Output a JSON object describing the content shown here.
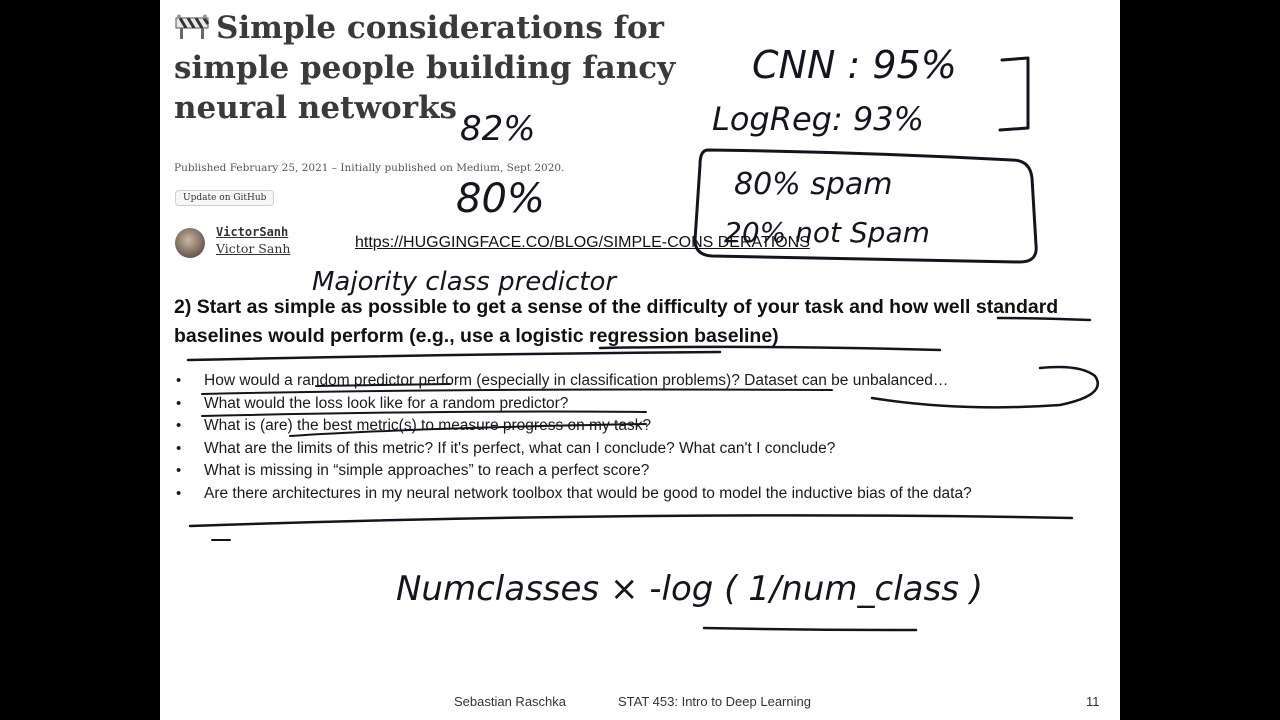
{
  "blog": {
    "icon": "construction-barrier-icon",
    "title": "Simple considerations for simple people building fancy neural networks",
    "published": "Published February 25, 2021 – Initially published on Medium, Sept 2020.",
    "github_button": "Update on GitHub",
    "author_handle": "VictorSanh",
    "author_name": "Victor Sanh",
    "url": "https://HUGGINGFACE.CO/BLOG/SIMPLE-CONS DERATIONS"
  },
  "slide": {
    "heading": "2)  Start as simple as possible to get a sense of the difficulty of your task and how well standard baselines would perform (e.g., use a logistic regression baseline)",
    "bullets": [
      "How would a random predictor perform (especially in classification problems)? Dataset can be unbalanced…",
      "What would the loss look like for a random predictor?",
      "What is (are) the best metric(s) to measure progress on my task?",
      "What are the limits of this metric? If it's perfect, what can I conclude? What can't I conclude?",
      "What is missing in “simple approaches” to reach a perfect score?",
      "Are there architectures in my neural network toolbox that would be good to model the inductive bias of the data?"
    ]
  },
  "annotations": {
    "cnn": "CNN : 95%",
    "logreg": "LogReg: 93%",
    "pct82": "82%",
    "pct80": "80%",
    "spam": "80% spam",
    "not_spam": "20% not Spam",
    "majority": "Majority class predictor",
    "formula": "Numclasses × -log ( 1/num_class )"
  },
  "footer": {
    "author": "Sebastian Raschka",
    "course": "STAT 453: Intro to Deep Learning",
    "page": "11"
  }
}
